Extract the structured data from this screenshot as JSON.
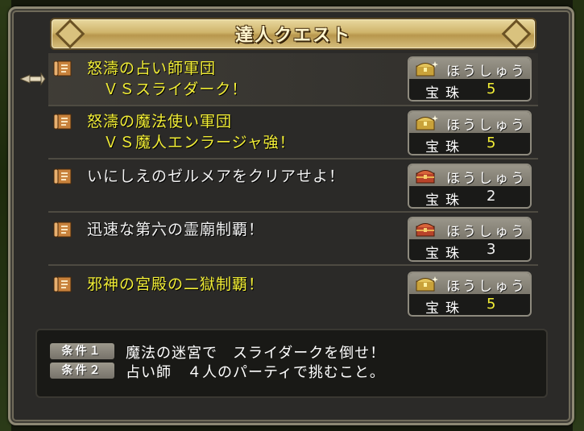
{
  "window": {
    "title": "達人クエスト"
  },
  "quests": [
    {
      "line1": "怒濤の占い師軍団",
      "line2": "　ＶＳスライダーク！",
      "color": "#f2ee36",
      "selected": true,
      "reward": {
        "label": "ほうしゅう",
        "item": "宝珠",
        "count": "5 こ",
        "chest": "gold-chest",
        "count_color": "#f2ee36"
      }
    },
    {
      "line1": "怒濤の魔法使い軍団",
      "line2": "　ＶＳ魔人エンラージャ強！",
      "color": "#f2ee36",
      "selected": false,
      "reward": {
        "label": "ほうしゅう",
        "item": "宝珠",
        "count": "5 こ",
        "chest": "gold-chest",
        "count_color": "#f2ee36"
      }
    },
    {
      "line1": "いにしえのゼルメアをクリアせよ！",
      "line2": "",
      "color": "#f2f2f2",
      "selected": false,
      "reward": {
        "label": "ほうしゅう",
        "item": "宝珠",
        "count": "2 こ",
        "chest": "red-chest",
        "count_color": "#f2f2f2"
      }
    },
    {
      "line1": "迅速な第六の霊廟制覇！",
      "line2": "",
      "color": "#f2f2f2",
      "selected": false,
      "reward": {
        "label": "ほうしゅう",
        "item": "宝珠",
        "count": "3 こ",
        "chest": "red-chest",
        "count_color": "#f2f2f2"
      }
    },
    {
      "line1": "邪神の宮殿の二獄制覇！",
      "line2": "",
      "color": "#f2ee36",
      "selected": false,
      "reward": {
        "label": "ほうしゅう",
        "item": "宝珠",
        "count": "5 こ",
        "chest": "gold-chest",
        "count_color": "#f2ee36"
      }
    }
  ],
  "conditions": [
    {
      "badge": "条件１",
      "text": "魔法の迷宮で　スライダークを倒せ！"
    },
    {
      "badge": "条件２",
      "text": "占い師　４人のパーティで挑むこと。"
    }
  ]
}
